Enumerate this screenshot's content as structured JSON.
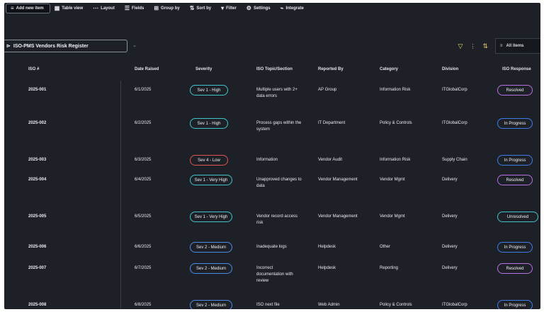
{
  "toolbar": {
    "items": [
      {
        "label": "Add new item",
        "icon": "≡"
      },
      {
        "label": "Table view",
        "icon": "▦"
      },
      {
        "label": "Layout",
        "icon": "⋯"
      },
      {
        "label": "Fields",
        "icon": "☰"
      },
      {
        "label": "Group by",
        "icon": "⊞"
      },
      {
        "label": "Sort by",
        "icon": "⇅"
      },
      {
        "label": "Filter",
        "icon": "▾"
      },
      {
        "label": "Settings",
        "icon": "⚙"
      },
      {
        "label": "Integrate",
        "icon": "⌁"
      }
    ]
  },
  "view": {
    "name": "ISO-PMS Vendors Risk Register"
  },
  "all_items_label": "All items",
  "columns": [
    "ISO #",
    "Date Raised",
    "Severity",
    "ISO Topic/Section",
    "Reported By",
    "Category",
    "Division",
    "ISO Response"
  ],
  "rows": [
    {
      "id": "2025-001",
      "date": "6/1/2025",
      "severity": "Sev 1 - High",
      "sev_color": "teal",
      "topic": "Multiple users with 2+ data errors",
      "reported": "AP Group",
      "category": "Information Risk",
      "division": "ITGlobalCorp",
      "status": "Resolved",
      "status_color": "purple"
    },
    {
      "id": "2025-002",
      "date": "6/2/2025",
      "severity": "Sev 1 - High",
      "sev_color": "teal",
      "topic": "Process gaps within the system",
      "reported": "IT Department",
      "category": "Policy & Controls",
      "division": "ITGlobalCorp",
      "status": "In Progress",
      "status_color": "blue"
    },
    {
      "id": "2025-003",
      "date": "6/3/2025",
      "severity": "Sev 4 - Low",
      "sev_color": "red",
      "topic": "Information",
      "reported": "Vendor Audit",
      "category": "Information Risk",
      "division": "Supply Chain",
      "status": "In Progress",
      "status_color": "blue"
    },
    {
      "id": "2025-004",
      "date": "6/4/2025",
      "severity": "Sev 1 - Very High",
      "sev_color": "teal",
      "topic": "Unapproved changes to data",
      "reported": "Vendor Management",
      "category": "Vendor Mgmt",
      "division": "Delivery",
      "status": "Resolved",
      "status_color": "purple"
    },
    {
      "id": "2025-005",
      "date": "6/5/2025",
      "severity": "Sev 1 - Very High",
      "sev_color": "teal",
      "topic": "Vendor record access risk",
      "reported": "Vendor Management",
      "category": "Vendor Mgmt",
      "division": "Delivery",
      "status": "Unresolved",
      "status_color": "teal"
    },
    {
      "id": "2025-006",
      "date": "6/6/2025",
      "severity": "Sev 2 - Medium",
      "sev_color": "blue",
      "topic": "Inadequate logs",
      "reported": "Helpdesk",
      "category": "Other",
      "division": "Delivery",
      "status": "In Progress",
      "status_color": "blue"
    },
    {
      "id": "2025-007",
      "date": "6/7/2025",
      "severity": "Sev 2 - Medium",
      "sev_color": "blue",
      "topic": "Incorrect documentation with review",
      "reported": "Helpdesk",
      "category": "Reporting",
      "division": "Delivery",
      "status": "Resolved",
      "status_color": "purple"
    },
    {
      "id": "2025-008",
      "date": "6/8/2025",
      "severity": "Sev 2 - Medium",
      "sev_color": "blue",
      "topic": "ISO next file",
      "reported": "Web Admin",
      "category": "Policy & Controls",
      "division": "ITGlobalCorp",
      "status": "In Progress",
      "status_color": "blue"
    }
  ]
}
